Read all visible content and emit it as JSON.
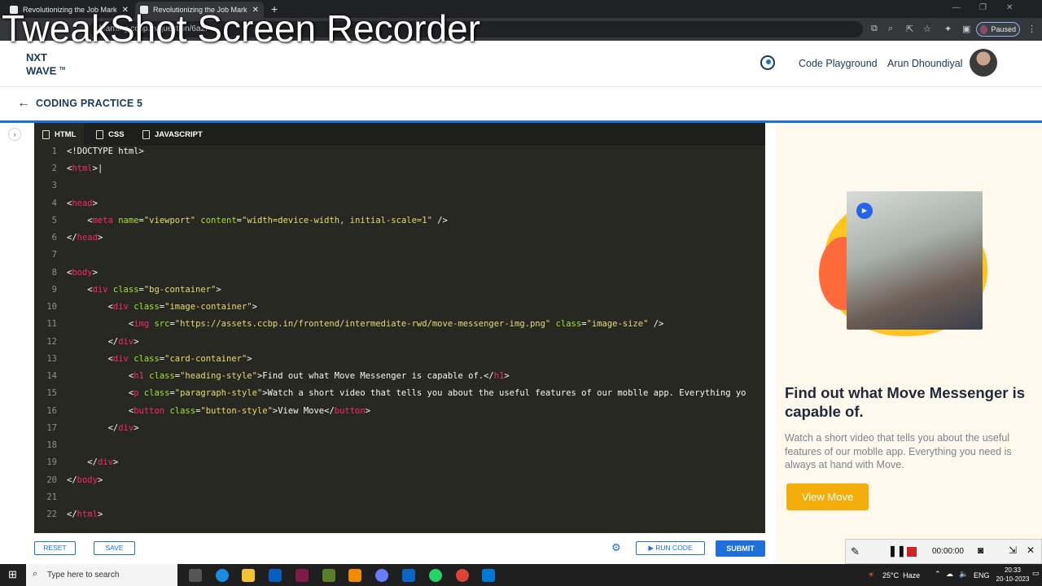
{
  "browser": {
    "tabs": [
      {
        "title": "Revolutionizing the Job Market"
      },
      {
        "title": "Revolutionizing the Job Market"
      }
    ],
    "url": "learning.ccbp.in/question/6a2f",
    "profile_status": "Paused"
  },
  "watermark": "TweakShot Screen Recorder",
  "header": {
    "logo": "NXT WAVE",
    "logo_tm": "TM",
    "links": [
      "Code Playground"
    ],
    "user_name": "Arun Dhoundiyal"
  },
  "page": {
    "title": "CODING PRACTICE 5"
  },
  "editor": {
    "tabs": [
      "HTML",
      "CSS",
      "JAVASCRIPT"
    ],
    "active_tab": "HTML"
  },
  "actions": {
    "reset": "RESET",
    "save": "SAVE",
    "run": "RUN CODE",
    "submit": "SUBMIT"
  },
  "preview": {
    "heading": "Find out what Move Messenger is capable of.",
    "paragraph": "Watch a short video that tells you about the useful features of our moblle app. Everything you need is always at hand with Move.",
    "button": "View Move"
  },
  "recorder": {
    "time": "00:00:00"
  },
  "taskbar": {
    "search_placeholder": "Type here to search",
    "weather": "25°C  Haze",
    "lang": "ENG",
    "time": "20:33",
    "date": "20-10-2023"
  },
  "colors": {
    "brand": "#183b56",
    "accent": "#1e6fd9",
    "preview_button": "#f4ae0c",
    "editor_bg": "#272822"
  }
}
